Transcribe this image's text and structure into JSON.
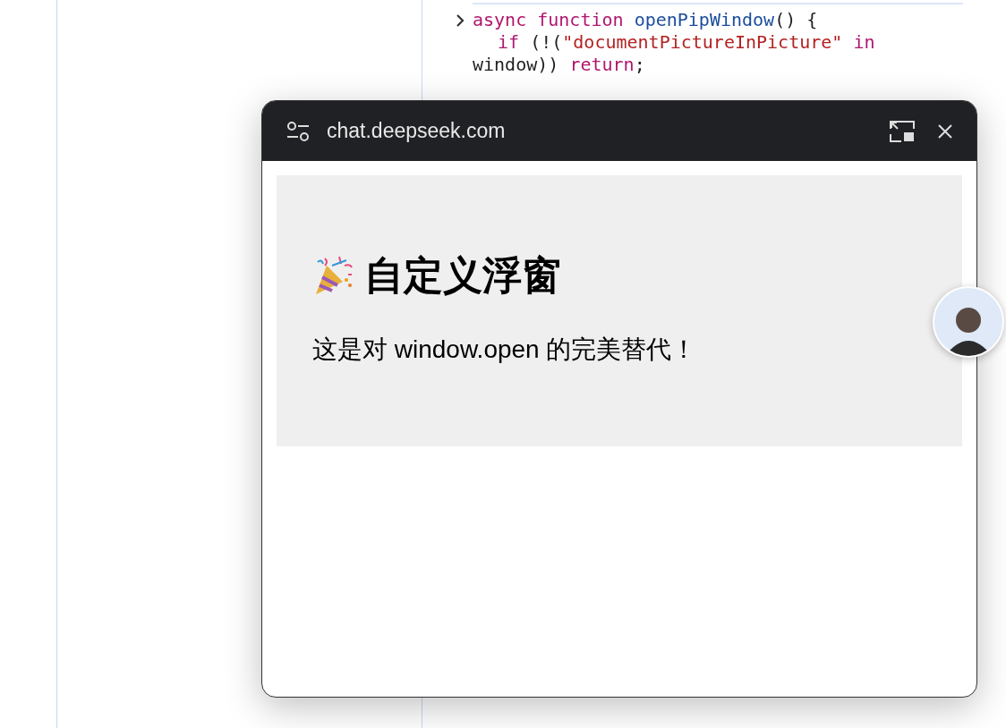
{
  "console": {
    "lines": [
      {
        "indented": false,
        "prompt": true,
        "tokens": [
          {
            "kind": "keyword",
            "text": "async function "
          },
          {
            "kind": "function",
            "text": "openPipWindow"
          },
          {
            "kind": "plain",
            "text": "() {"
          }
        ]
      },
      {
        "indented": true,
        "prompt": false,
        "tokens": [
          {
            "kind": "keyword",
            "text": "if"
          },
          {
            "kind": "plain",
            "text": " (!("
          },
          {
            "kind": "string",
            "text": "\"documentPictureInPicture\""
          },
          {
            "kind": "keyword",
            "text": " in"
          }
        ]
      },
      {
        "indented": false,
        "prompt": false,
        "tokens": [
          {
            "kind": "plain",
            "text": "window)) "
          },
          {
            "kind": "keyword",
            "text": "return"
          },
          {
            "kind": "plain",
            "text": ";"
          }
        ]
      }
    ]
  },
  "pip_window": {
    "title": "chat.deepseek.com",
    "heading": "自定义浮窗",
    "body": "这是对 window.open 的完美替代！"
  }
}
